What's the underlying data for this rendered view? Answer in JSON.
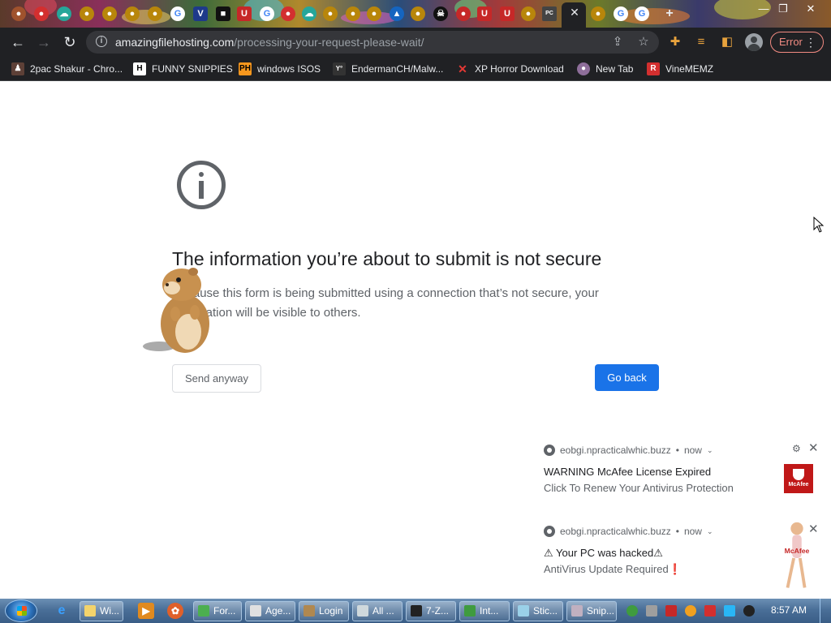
{
  "browser": {
    "url_domain": "amazingfilehosting.com",
    "url_path": "/processing-your-request-please-wait/",
    "profile_status": "Error"
  },
  "bookmarks": [
    {
      "label": "2pac Shakur - Chro...",
      "icon": "tupac-favicon",
      "color": "#c0392b"
    },
    {
      "label": "FUNNY SNIPPIES",
      "icon": "h-favicon",
      "color": "#ffffff"
    },
    {
      "label": "windows ISOS",
      "icon": "ph-favicon",
      "color": "#f7971d"
    },
    {
      "label": "EndermanCH/Malw...",
      "icon": "yt-favicon",
      "color": "#333333"
    },
    {
      "label": "XP Horror Download",
      "icon": "x-favicon",
      "color": "#e53935"
    },
    {
      "label": "New Tab",
      "icon": "newtab-favicon",
      "color": "#8e6e9a"
    },
    {
      "label": "VineMEMZ",
      "icon": "r-favicon",
      "color": "#d32f2f"
    }
  ],
  "page": {
    "title": "The information you’re about to submit is not secure",
    "body_line1": "Because this form is being submitted using a connection that’s not secure, your",
    "body_line2": "information will be visible to others.",
    "send_anyway_label": "Send anyway",
    "go_back_label": "Go back"
  },
  "notifications": [
    {
      "source": "eobgi.npracticalwhic.buzz",
      "time": "now",
      "title": "WARNING McAfee License Expired",
      "message": "Click To Renew Your Antivirus Protection",
      "logo_text": "McAfee"
    },
    {
      "source": "eobgi.npracticalwhic.buzz",
      "time": "now",
      "title": "⚠ Your PC was hacked⚠",
      "message": "AntiVirus Update Required❗",
      "logo_text": "McAfee"
    }
  ],
  "taskbar": {
    "tasks": [
      {
        "label": "Wi...",
        "color": "#f3d36b"
      },
      {
        "label": "For...",
        "color": "#4caf50"
      },
      {
        "label": "Age...",
        "color": "#e0e0e0"
      },
      {
        "label": "Login",
        "color": "#b08850"
      },
      {
        "label": "All ...",
        "color": "#cfd8dc"
      },
      {
        "label": "7-Z...",
        "color": "#222222"
      },
      {
        "label": "Int...",
        "color": "#3f9b3f"
      },
      {
        "label": "Stic...",
        "color": "#9ad0e8"
      },
      {
        "label": "Snip...",
        "color": "#c0b0c0"
      }
    ],
    "clock": "8:57 AM"
  }
}
